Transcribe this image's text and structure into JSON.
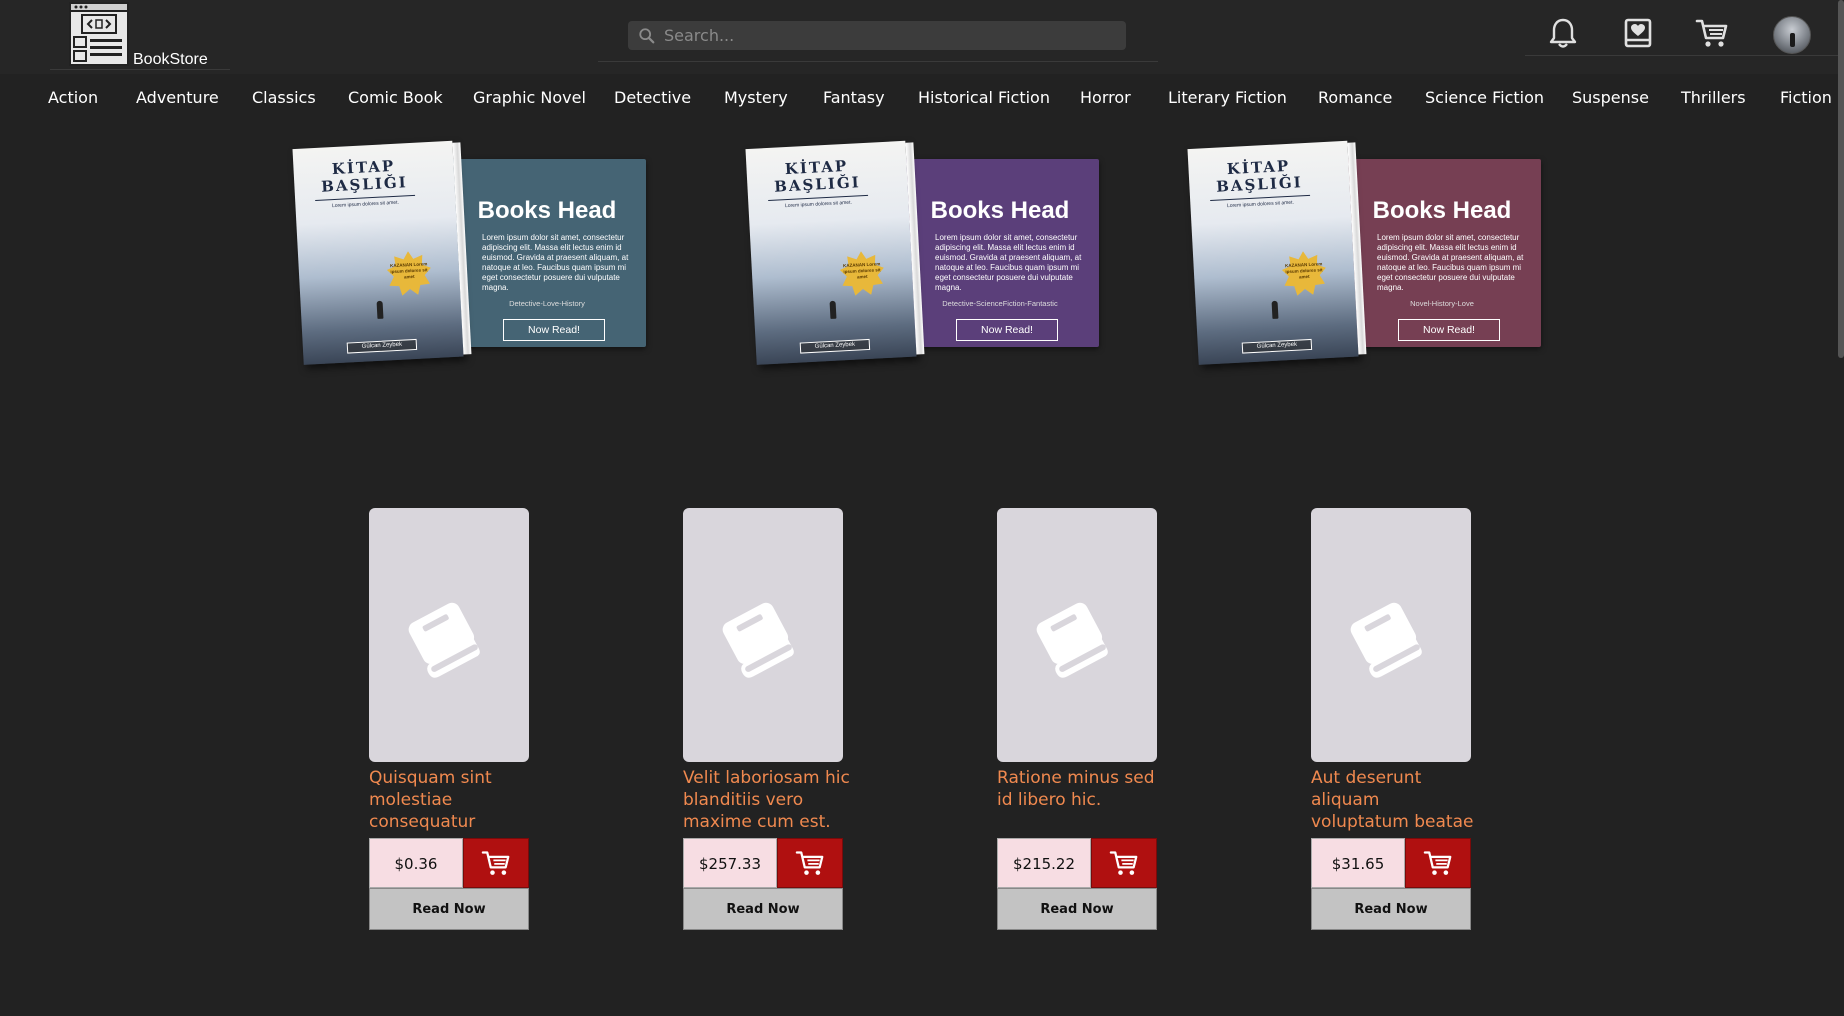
{
  "header": {
    "logo_text": "BookStore",
    "search_placeholder": "Search..."
  },
  "nav": {
    "categories": [
      "Action",
      "Adventure",
      "Classics",
      "Comic Book",
      "Graphic Novel",
      "Detective",
      "Mystery",
      "Fantasy",
      "Historical Fiction",
      "Horror",
      "Literary Fiction",
      "Romance",
      "Science Fiction",
      "Suspense",
      "Thrillers",
      "Fiction"
    ]
  },
  "promos": [
    {
      "head": "Books Head",
      "desc": "Lorem ipsum dolor sit amet, consectetur adipiscing elit. Massa elit lectus enim id euismod. Gravida at praesent aliquam, at natoque at leo. Faucibus quam ipsum mi eget consectetur posuere dui vulputate magna.",
      "tags": "Detective-Love-History",
      "button": "Now Read!",
      "color": "#456474",
      "cover_title": "KİTAP BAŞLIĞI",
      "cover_sub": "Lorem ipsum dolores sit amet.",
      "seal": "KAZANAN Lorem ipsum dolores sit amet",
      "author": "Gülcan Zeybek"
    },
    {
      "head": "Books Head",
      "desc": "Lorem ipsum dolor sit amet, consectetur adipiscing elit. Massa elit lectus enim id euismod. Gravida at praesent aliquam, at natoque at leo. Faucibus quam ipsum mi eget consectetur posuere dui vulputate magna.",
      "tags": "Detective-ScienceFiction-Fantastic",
      "button": "Now Read!",
      "color": "#5b3f7a",
      "cover_title": "KİTAP BAŞLIĞI",
      "cover_sub": "Lorem ipsum dolores sit amet.",
      "seal": "KAZANAN Lorem ipsum dolores sit amet",
      "author": "Gülcan Zeybek"
    },
    {
      "head": "Books Head",
      "desc": "Lorem ipsum dolor sit amet, consectetur adipiscing elit. Massa elit lectus enim id euismod. Gravida at praesent aliquam, at natoque at leo. Faucibus quam ipsum mi eget consectetur posuere dui vulputate magna.",
      "tags": "Novel-History-Love",
      "button": "Now Read!",
      "color": "#763f53",
      "cover_title": "KİTAP BAŞLIĞI",
      "cover_sub": "Lorem ipsum dolores sit amet.",
      "seal": "KAZANAN Lorem ipsum dolores sit amet",
      "author": "Gülcan Zeybek"
    }
  ],
  "products": [
    {
      "title": "Quisquam sint molestiae consequatur",
      "price": "$0.36",
      "read_label": "Read Now"
    },
    {
      "title": "Velit laboriosam hic blanditiis vero maxime cum est.",
      "price": "$257.33",
      "read_label": "Read Now"
    },
    {
      "title": "Ratione minus sed id libero hic.",
      "price": "$215.22",
      "read_label": "Read Now"
    },
    {
      "title": "Aut deserunt aliquam voluptatum beatae",
      "price": "$31.65",
      "read_label": "Read Now"
    }
  ],
  "icons": {
    "logo": "layout-template-icon",
    "search": "search-icon",
    "notifications": "bell-icon",
    "favorites": "heart-book-icon",
    "cart": "cart-icon",
    "product_placeholder": "book-icon"
  },
  "colors": {
    "background": "#222222",
    "title": "#f0894f",
    "price_bg": "#f7dde3",
    "cart_bg": "#b01010",
    "read_bg": "#c3c3c3"
  }
}
